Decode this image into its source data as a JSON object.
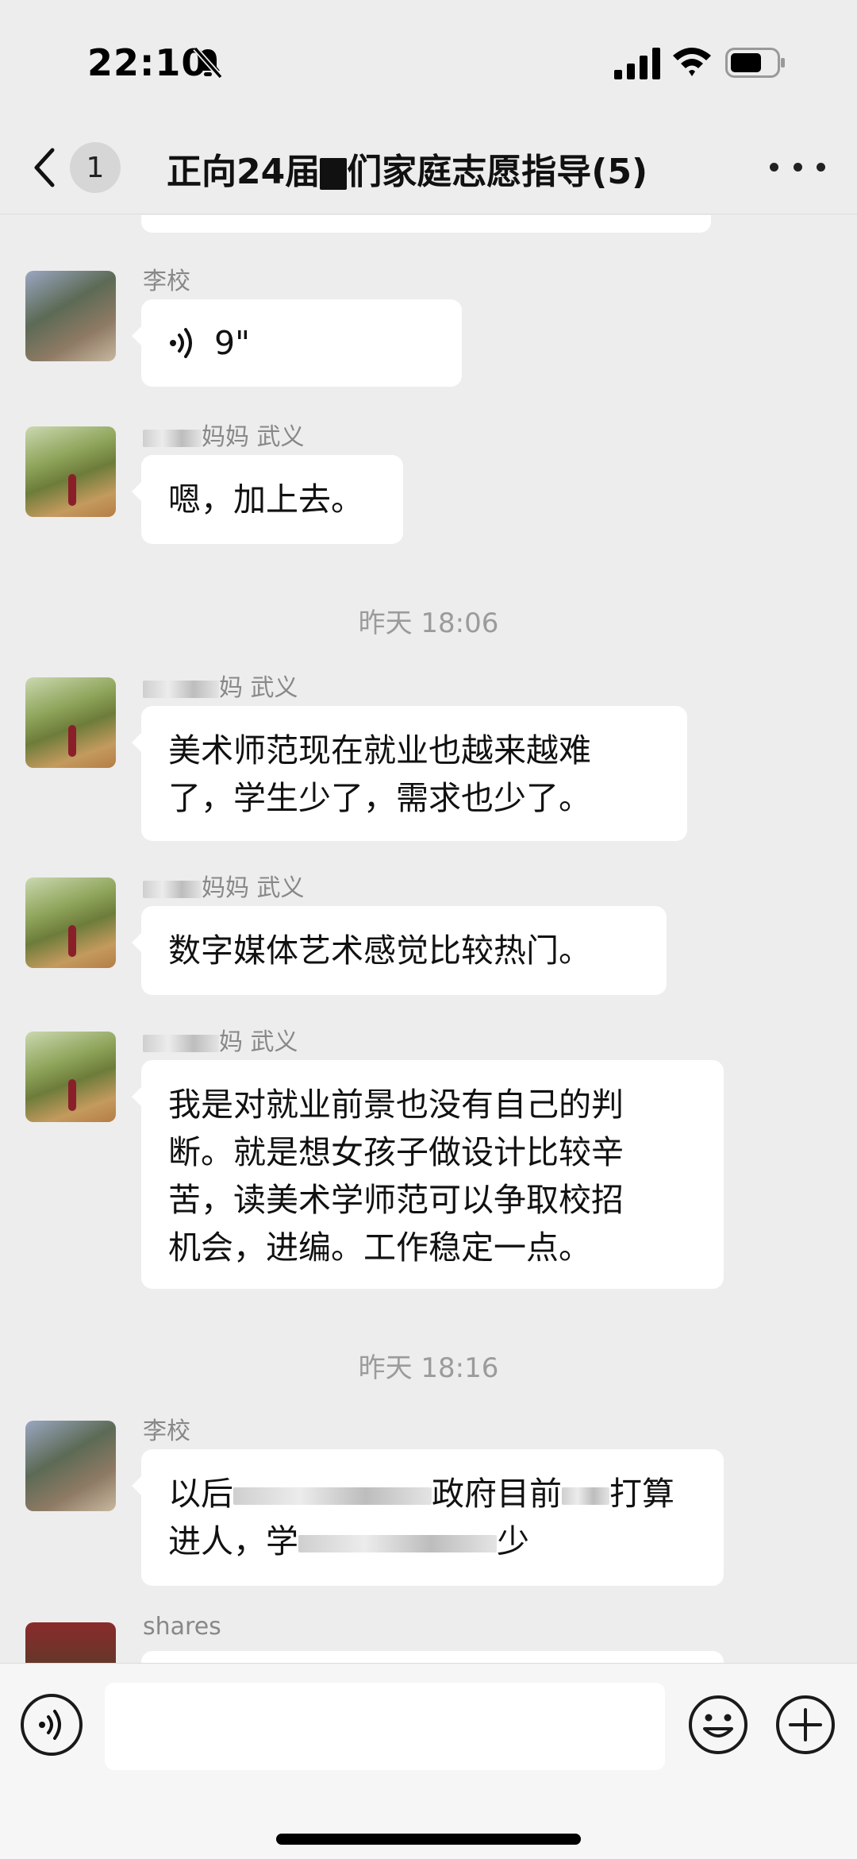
{
  "status_bar": {
    "time": "22:10"
  },
  "nav": {
    "unread_count": "1",
    "title_prefix": "正向24届",
    "title_suffix": "们家庭志愿指导(5)"
  },
  "messages": [
    {
      "type": "voice",
      "sender": "李校",
      "duration": "9\""
    },
    {
      "type": "text",
      "sender_suffix": "妈妈 武义",
      "text": "嗯，加上去。"
    },
    {
      "type": "text",
      "sender_suffix": "妈 武义",
      "text_lines": [
        "美术师范现在就业也越来越难",
        "了，学生少了，需求也少了。"
      ]
    },
    {
      "type": "text",
      "sender_suffix": "妈妈 武义",
      "text": "数字媒体艺术感觉比较热门。"
    },
    {
      "type": "text",
      "sender_suffix": "妈 武义",
      "text_lines": [
        "我是对就业前景也没有自己的判",
        "断。就是想女孩子做设计比较辛",
        "苦，读美术学师范可以争取校招",
        "机会，进编。工作稳定一点。"
      ]
    },
    {
      "type": "text",
      "sender": "李校",
      "line1_parts": [
        "以后",
        "政府目前",
        "打算"
      ],
      "line2_parts": [
        "进人，学",
        "少"
      ]
    },
    {
      "type": "text",
      "sender": "shares"
    }
  ],
  "timestamps": [
    "昨天 18:06",
    "昨天 18:16"
  ],
  "input": {
    "placeholder": ""
  },
  "icons": [
    "bell-slash-icon",
    "signal-icon",
    "wifi-icon",
    "battery-icon",
    "back-icon",
    "more-icon",
    "voice-icon",
    "emoji-icon",
    "plus-icon"
  ]
}
